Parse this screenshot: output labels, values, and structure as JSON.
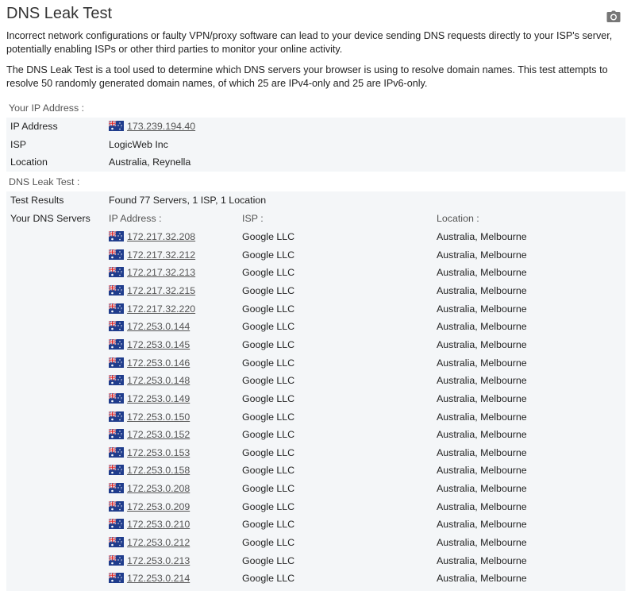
{
  "title": "DNS Leak Test",
  "camera_icon": "camera-icon",
  "intro": [
    "Incorrect network configurations or faulty VPN/proxy software can lead to your device sending DNS requests directly to your ISP's server, potentially enabling ISPs or other third parties to monitor your online activity.",
    "The DNS Leak Test is a tool used to determine which DNS servers your browser is using to resolve domain names. This test attempts to resolve 50 randomly generated domain names, of which 25 are IPv4-only and 25 are IPv6-only."
  ],
  "your_ip": {
    "heading": "Your IP Address :",
    "ip_label": "IP Address",
    "ip_value": "173.239.194.40",
    "isp_label": "ISP",
    "isp_value": "LogicWeb Inc",
    "location_label": "Location",
    "location_value": "Australia, Reynella",
    "flag": "australia-flag"
  },
  "dns_test": {
    "heading": "DNS Leak Test :",
    "results_label": "Test Results",
    "results_value": "Found 77 Servers, 1 ISP, 1 Location",
    "servers_label": "Your DNS Servers",
    "col_ip": "IP Address :",
    "col_isp": "ISP :",
    "col_location": "Location :",
    "servers": [
      {
        "ip": "172.217.32.208",
        "isp": "Google LLC",
        "location": "Australia, Melbourne"
      },
      {
        "ip": "172.217.32.212",
        "isp": "Google LLC",
        "location": "Australia, Melbourne"
      },
      {
        "ip": "172.217.32.213",
        "isp": "Google LLC",
        "location": "Australia, Melbourne"
      },
      {
        "ip": "172.217.32.215",
        "isp": "Google LLC",
        "location": "Australia, Melbourne"
      },
      {
        "ip": "172.217.32.220",
        "isp": "Google LLC",
        "location": "Australia, Melbourne"
      },
      {
        "ip": "172.253.0.144",
        "isp": "Google LLC",
        "location": "Australia, Melbourne"
      },
      {
        "ip": "172.253.0.145",
        "isp": "Google LLC",
        "location": "Australia, Melbourne"
      },
      {
        "ip": "172.253.0.146",
        "isp": "Google LLC",
        "location": "Australia, Melbourne"
      },
      {
        "ip": "172.253.0.148",
        "isp": "Google LLC",
        "location": "Australia, Melbourne"
      },
      {
        "ip": "172.253.0.149",
        "isp": "Google LLC",
        "location": "Australia, Melbourne"
      },
      {
        "ip": "172.253.0.150",
        "isp": "Google LLC",
        "location": "Australia, Melbourne"
      },
      {
        "ip": "172.253.0.152",
        "isp": "Google LLC",
        "location": "Australia, Melbourne"
      },
      {
        "ip": "172.253.0.153",
        "isp": "Google LLC",
        "location": "Australia, Melbourne"
      },
      {
        "ip": "172.253.0.158",
        "isp": "Google LLC",
        "location": "Australia, Melbourne"
      },
      {
        "ip": "172.253.0.208",
        "isp": "Google LLC",
        "location": "Australia, Melbourne"
      },
      {
        "ip": "172.253.0.209",
        "isp": "Google LLC",
        "location": "Australia, Melbourne"
      },
      {
        "ip": "172.253.0.210",
        "isp": "Google LLC",
        "location": "Australia, Melbourne"
      },
      {
        "ip": "172.253.0.212",
        "isp": "Google LLC",
        "location": "Australia, Melbourne"
      },
      {
        "ip": "172.253.0.213",
        "isp": "Google LLC",
        "location": "Australia, Melbourne"
      },
      {
        "ip": "172.253.0.214",
        "isp": "Google LLC",
        "location": "Australia, Melbourne"
      }
    ]
  }
}
